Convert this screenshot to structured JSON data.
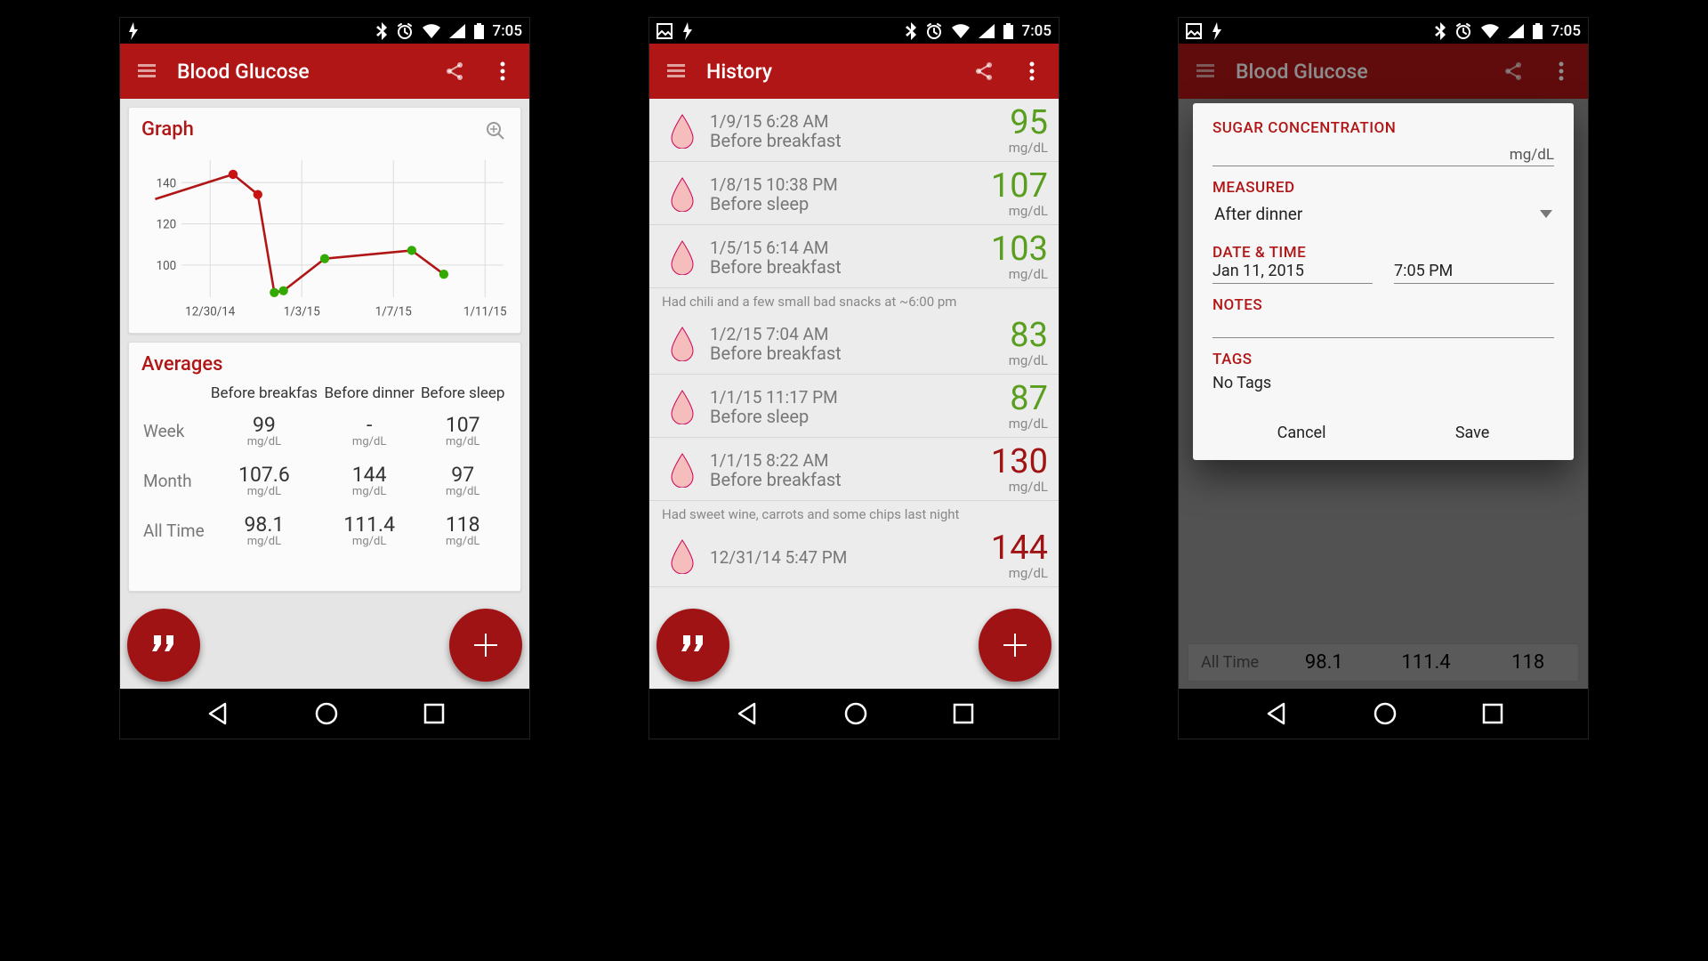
{
  "status": {
    "time": "7:05"
  },
  "apps": {
    "glucose_title": "Blood Glucose",
    "history_title": "History"
  },
  "graph": {
    "title": "Graph",
    "xticks": [
      "12/30/14",
      "1/3/15",
      "1/7/15",
      "1/11/15"
    ],
    "yticks": [
      100,
      120,
      140
    ]
  },
  "averages": {
    "title": "Averages",
    "cols": [
      "Before breakfas",
      "Before dinner",
      "Before sleep"
    ],
    "rows": [
      {
        "label": "Week",
        "vals": [
          "99",
          "-",
          "107"
        ]
      },
      {
        "label": "Month",
        "vals": [
          "107.6",
          "144",
          "97"
        ]
      },
      {
        "label": "All Time",
        "vals": [
          "98.1",
          "111.4",
          "118"
        ]
      }
    ],
    "unit": "mg/dL"
  },
  "history": [
    {
      "ts": "1/9/15 6:28 AM",
      "ctx": "Before breakfast",
      "val": "95",
      "cls": "good"
    },
    {
      "ts": "1/8/15 10:38 PM",
      "ctx": "Before sleep",
      "val": "107",
      "cls": "good"
    },
    {
      "ts": "1/5/15 6:14 AM",
      "ctx": "Before breakfast",
      "val": "103",
      "cls": "good",
      "note": "Had chili and a few small bad snacks at ~6:00 pm"
    },
    {
      "ts": "1/2/15 7:04 AM",
      "ctx": "Before breakfast",
      "val": "83",
      "cls": "good"
    },
    {
      "ts": "1/1/15 11:17 PM",
      "ctx": "Before sleep",
      "val": "87",
      "cls": "good"
    },
    {
      "ts": "1/1/15 8:22 AM",
      "ctx": "Before breakfast",
      "val": "130",
      "cls": "bad",
      "note": "Had sweet wine, carrots and some chips last night"
    },
    {
      "ts": "12/31/14 5:47 PM",
      "ctx": "",
      "val": "144",
      "cls": "bad"
    }
  ],
  "dialog": {
    "sugar_label": "SUGAR CONCENTRATION",
    "sugar_unit": "mg/dL",
    "measured_label": "MEASURED",
    "measured_value": "After dinner",
    "datetime_label": "DATE & TIME",
    "date_value": "Jan 11, 2015",
    "time_value": "7:05 PM",
    "notes_label": "NOTES",
    "tags_label": "TAGS",
    "tags_value": "No Tags",
    "cancel": "Cancel",
    "save": "Save"
  },
  "chart_data": {
    "type": "line",
    "x": [
      "12/28/14",
      "12/31/14",
      "1/1/15",
      "1/1/15b",
      "1/2/15",
      "1/5/15",
      "1/8/15",
      "1/9/15"
    ],
    "values": [
      128,
      144,
      130,
      87,
      83,
      103,
      107,
      95
    ],
    "title": "Graph",
    "xlabel": "",
    "ylabel": "",
    "ylim": [
      80,
      150
    ],
    "xlim_labels": [
      "12/30/14",
      "1/3/15",
      "1/7/15",
      "1/11/15"
    ],
    "point_flags": [
      "red",
      "red",
      "red",
      "green",
      "green",
      "green",
      "green",
      "green"
    ]
  }
}
